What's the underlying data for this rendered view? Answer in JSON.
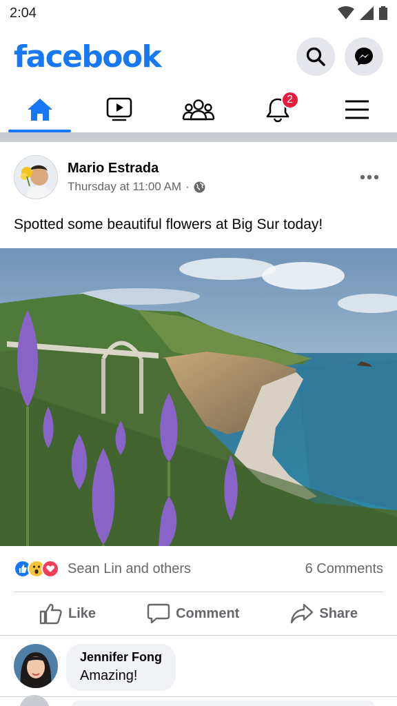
{
  "status_bar": {
    "time": "2:04"
  },
  "header": {
    "logo": "facebook",
    "search_icon": "search-icon",
    "messenger_icon": "messenger-icon"
  },
  "nav": {
    "tabs": [
      {
        "name": "home",
        "icon": "home-icon",
        "active": true
      },
      {
        "name": "watch",
        "icon": "video-icon",
        "active": false
      },
      {
        "name": "groups",
        "icon": "groups-icon",
        "active": false
      },
      {
        "name": "notifications",
        "icon": "bell-icon",
        "active": false,
        "badge": "2"
      },
      {
        "name": "menu",
        "icon": "hamburger-icon",
        "active": false
      }
    ]
  },
  "post": {
    "author": "Mario Estrada",
    "time": "Thursday at 11:00 AM",
    "separator": "·",
    "audience_icon": "globe-icon",
    "text": "Spotted some beautiful flowers at Big Sur today!",
    "reactions": {
      "icons": [
        "like-reaction",
        "wow-reaction",
        "love-reaction"
      ],
      "summary": "Sean Lin and others",
      "comments": "6 Comments"
    },
    "actions": {
      "like": "Like",
      "comment": "Comment",
      "share": "Share"
    }
  },
  "comment": {
    "author": "Jennifer Fong",
    "text": "Amazing!"
  },
  "colors": {
    "brand": "#1877f2",
    "badge": "#e41e3f",
    "secondary_text": "#65676b"
  }
}
